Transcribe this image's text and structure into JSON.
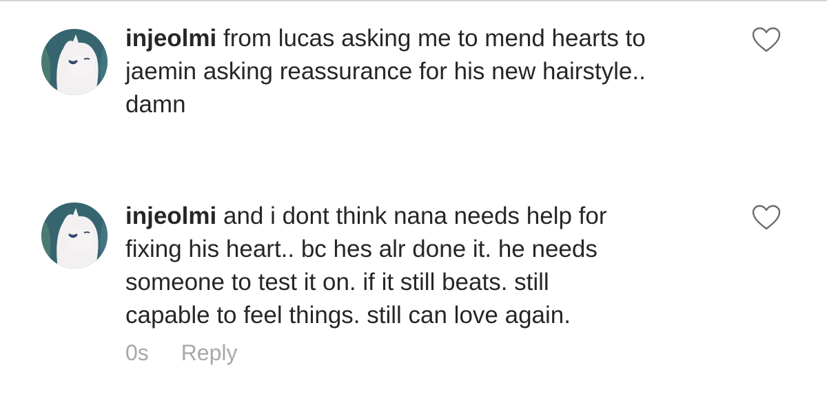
{
  "comments": [
    {
      "username": "injeolmi",
      "text": " from lucas asking me to mend hearts to\njaemin asking reassurance for his new hairstyle..\ndamn",
      "like_icon": "heart-outline-icon",
      "avatar_icon": "moomin-avatar"
    },
    {
      "username": "injeolmi",
      "text": " and i dont think nana needs help for\nfixing his heart.. bc hes alr done it. he needs\nsomeone to test it on. if it still beats. still\ncapable to feel things. still can love again.",
      "timestamp": "0s",
      "reply_label": "Reply",
      "like_icon": "heart-outline-icon",
      "avatar_icon": "moomin-avatar"
    }
  ],
  "colors": {
    "text": "#262626",
    "muted": "#a8a8a8",
    "divider": "#d4d4d4",
    "avatar_bg": "#3d6f7a"
  }
}
